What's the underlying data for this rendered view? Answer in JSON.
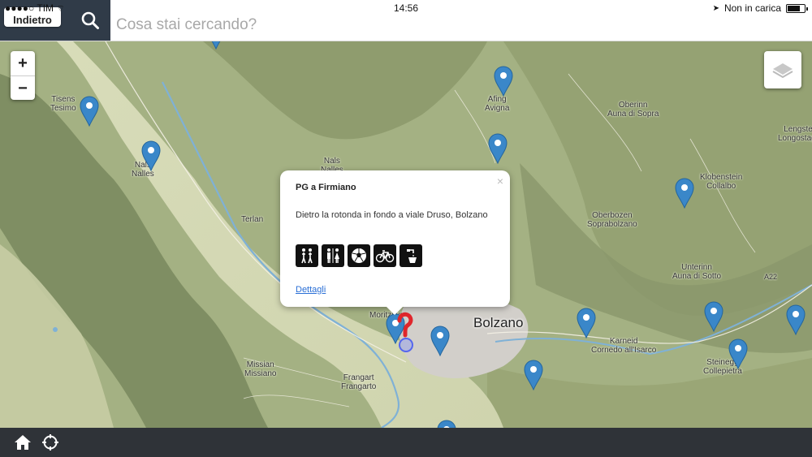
{
  "statusbar": {
    "carrier": "TIM",
    "time": "14:56",
    "network_status": "Non in carica"
  },
  "topbar": {
    "back_label": "Indietro",
    "search_placeholder": "Cosa stai cercando?"
  },
  "map": {
    "zoom_in": "+",
    "zoom_out": "−",
    "city_label": "Bolzano",
    "places": [
      {
        "name": "Tisens",
        "alt": "Tesimo"
      },
      {
        "name": "Nals",
        "alt": "Nalles"
      },
      {
        "name": "Nals",
        "alt": "Nalles"
      },
      {
        "name": "Terlan",
        "alt": ""
      },
      {
        "name": "Afing",
        "alt": "Avigna"
      },
      {
        "name": "Oberinn",
        "alt": "Auna di Sopra"
      },
      {
        "name": "Lengstein",
        "alt": "Longostagno"
      },
      {
        "name": "Klobenstein",
        "alt": "Collalbo"
      },
      {
        "name": "Oberbozen",
        "alt": "Soprabolzano"
      },
      {
        "name": "Unterinn",
        "alt": "Auna di Sotto"
      },
      {
        "name": "Karneid",
        "alt": "Cornedo all'Isarco"
      },
      {
        "name": "Steinegg",
        "alt": "Collepietra"
      },
      {
        "name": "Missian",
        "alt": "Missiano"
      },
      {
        "name": "Frangart",
        "alt": "Frangarto"
      },
      {
        "name": "Moritzing",
        "alt": ""
      }
    ],
    "highway_label": "A22"
  },
  "popup": {
    "title": "PG a Firmiano",
    "address": "Dietro la rotonda in fondo a viale Druso, Bolzano",
    "amenities": [
      "hiking-icon",
      "toilets-icon",
      "soccer-icon",
      "bicycle-icon",
      "fountain-icon"
    ],
    "details_link": "Dettagli",
    "close": "×"
  },
  "bottombar": {
    "icons": [
      "home-icon",
      "locate-icon"
    ]
  },
  "colors": {
    "marker_blue": "#3a87c9",
    "marker_red": "#e0262c",
    "topbar_dark": "#303b48",
    "bottombar": "#2f3338"
  }
}
